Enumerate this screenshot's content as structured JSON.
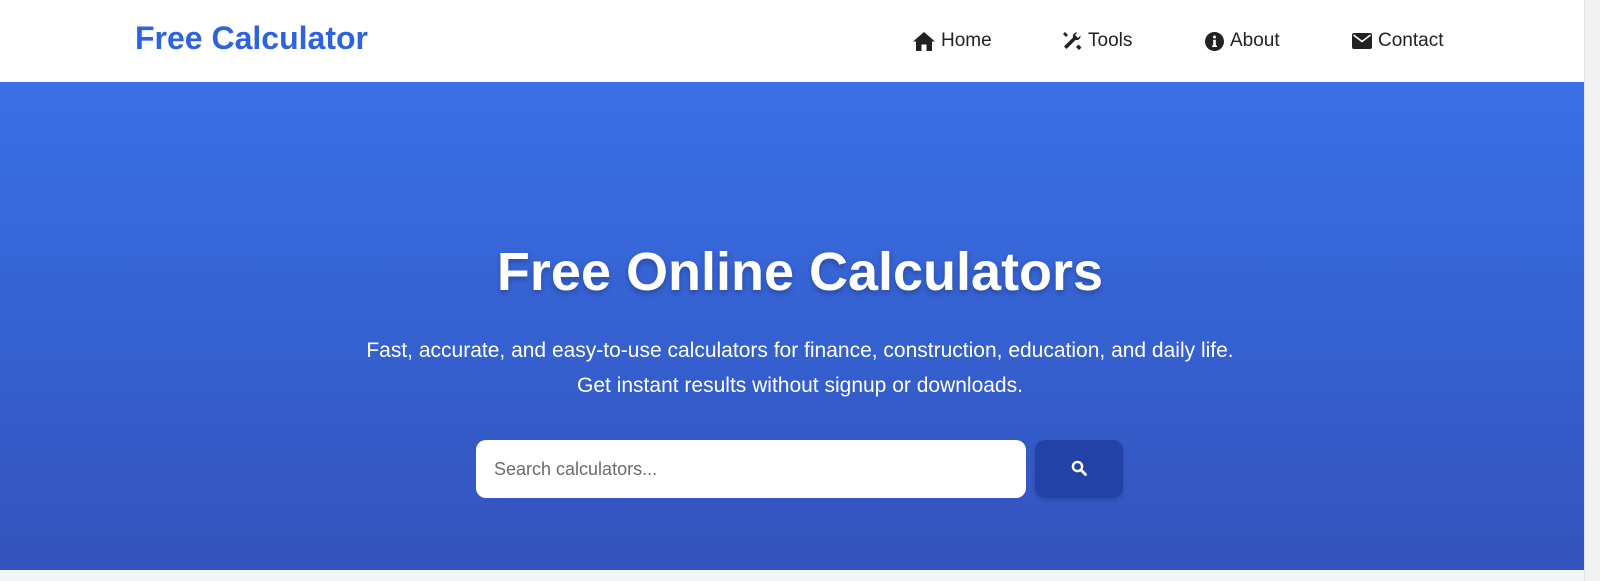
{
  "header": {
    "brand": "Free Calculator",
    "nav": [
      {
        "label": "Home",
        "icon": "home-icon"
      },
      {
        "label": "Tools",
        "icon": "tools-icon"
      },
      {
        "label": "About",
        "icon": "info-icon"
      },
      {
        "label": "Contact",
        "icon": "envelope-icon"
      }
    ]
  },
  "hero": {
    "title": "Free Online Calculators",
    "subtitle": "Fast, accurate, and easy-to-use calculators for finance, construction, education, and daily life. Get instant results without signup or downloads.",
    "search": {
      "placeholder": "Search calculators...",
      "value": "",
      "button_icon": "search-icon"
    }
  },
  "colors": {
    "brand": "#2b63e0",
    "hero_top": "#3a70e6",
    "hero_bottom": "#3353bd",
    "search_button": "#2143a8"
  }
}
